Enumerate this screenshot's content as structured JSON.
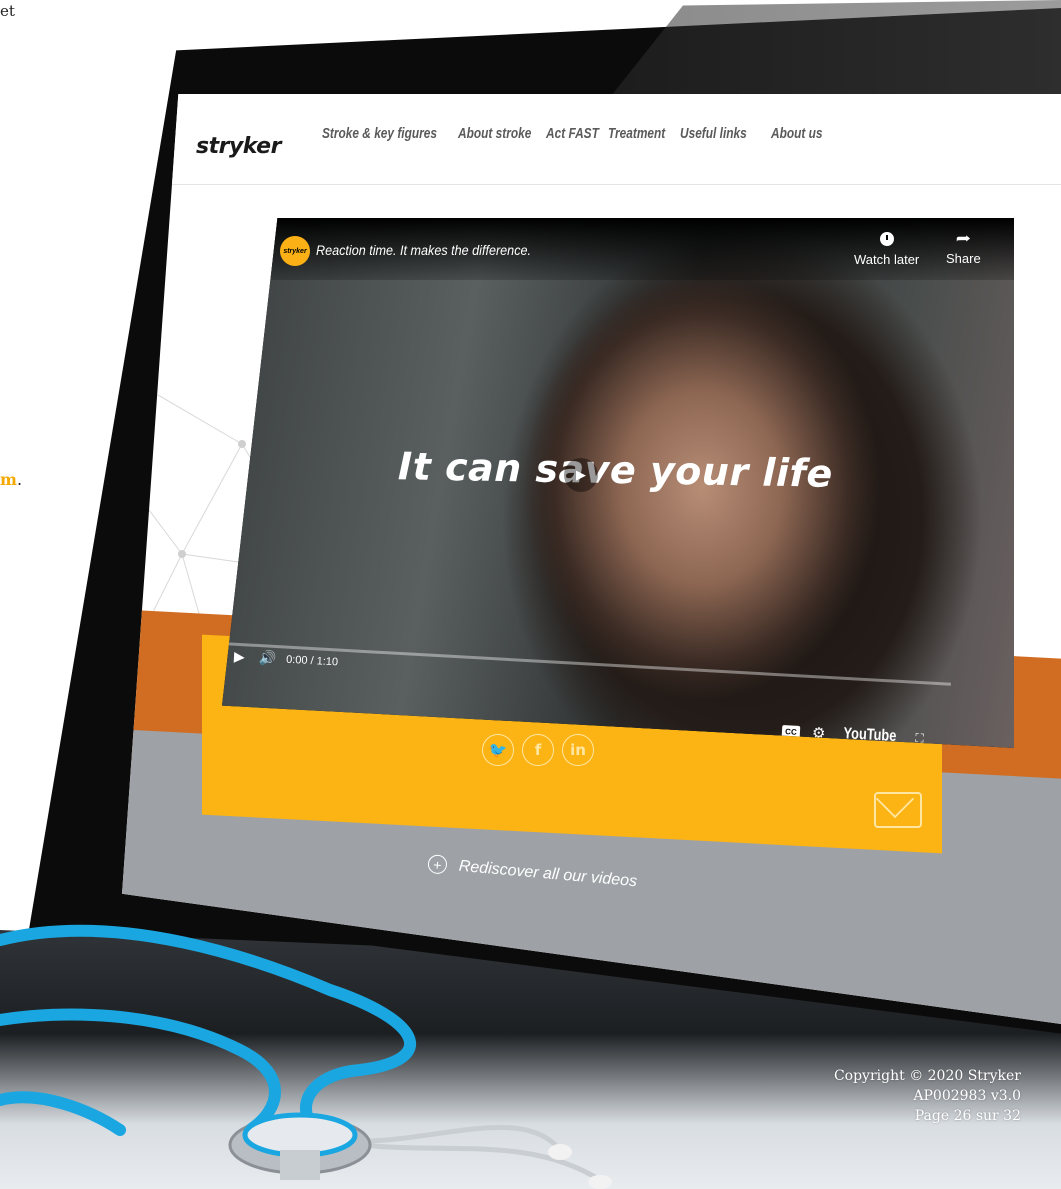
{
  "fragments": {
    "top_left_text": "et",
    "mid_left_text": "m",
    "mid_left_punct": "."
  },
  "website": {
    "logo": "stryker",
    "nav": [
      "Stroke & key figures",
      "About stroke",
      "Act FAST",
      "Treatment",
      "Useful links",
      "About us"
    ],
    "rediscover_label": "Rediscover all our videos"
  },
  "video": {
    "channel_logo_text": "stryker",
    "title": "Reaction time. It makes the difference.",
    "watch_later_label": "Watch later",
    "share_label": "Share",
    "overlay_text": "It can save your life",
    "time_display": "0:00 / 1:10",
    "youtube_label": "YouTube",
    "progress": 0
  },
  "social": {
    "icons": [
      "twitter-icon",
      "facebook-icon",
      "linkedin-icon"
    ],
    "glyphs": [
      "🐦",
      "f",
      "in"
    ]
  },
  "footer": {
    "copyright": "Copyright © 2020 Stryker",
    "doc_id": "AP002983 v3.0",
    "page": "Page 26 sur 32"
  },
  "colors": {
    "brand_yellow": "#fcb414",
    "brand_orange": "#d16d22",
    "grey_band": "#9ea2a6",
    "stethoscope_blue": "#1aa6e0"
  }
}
